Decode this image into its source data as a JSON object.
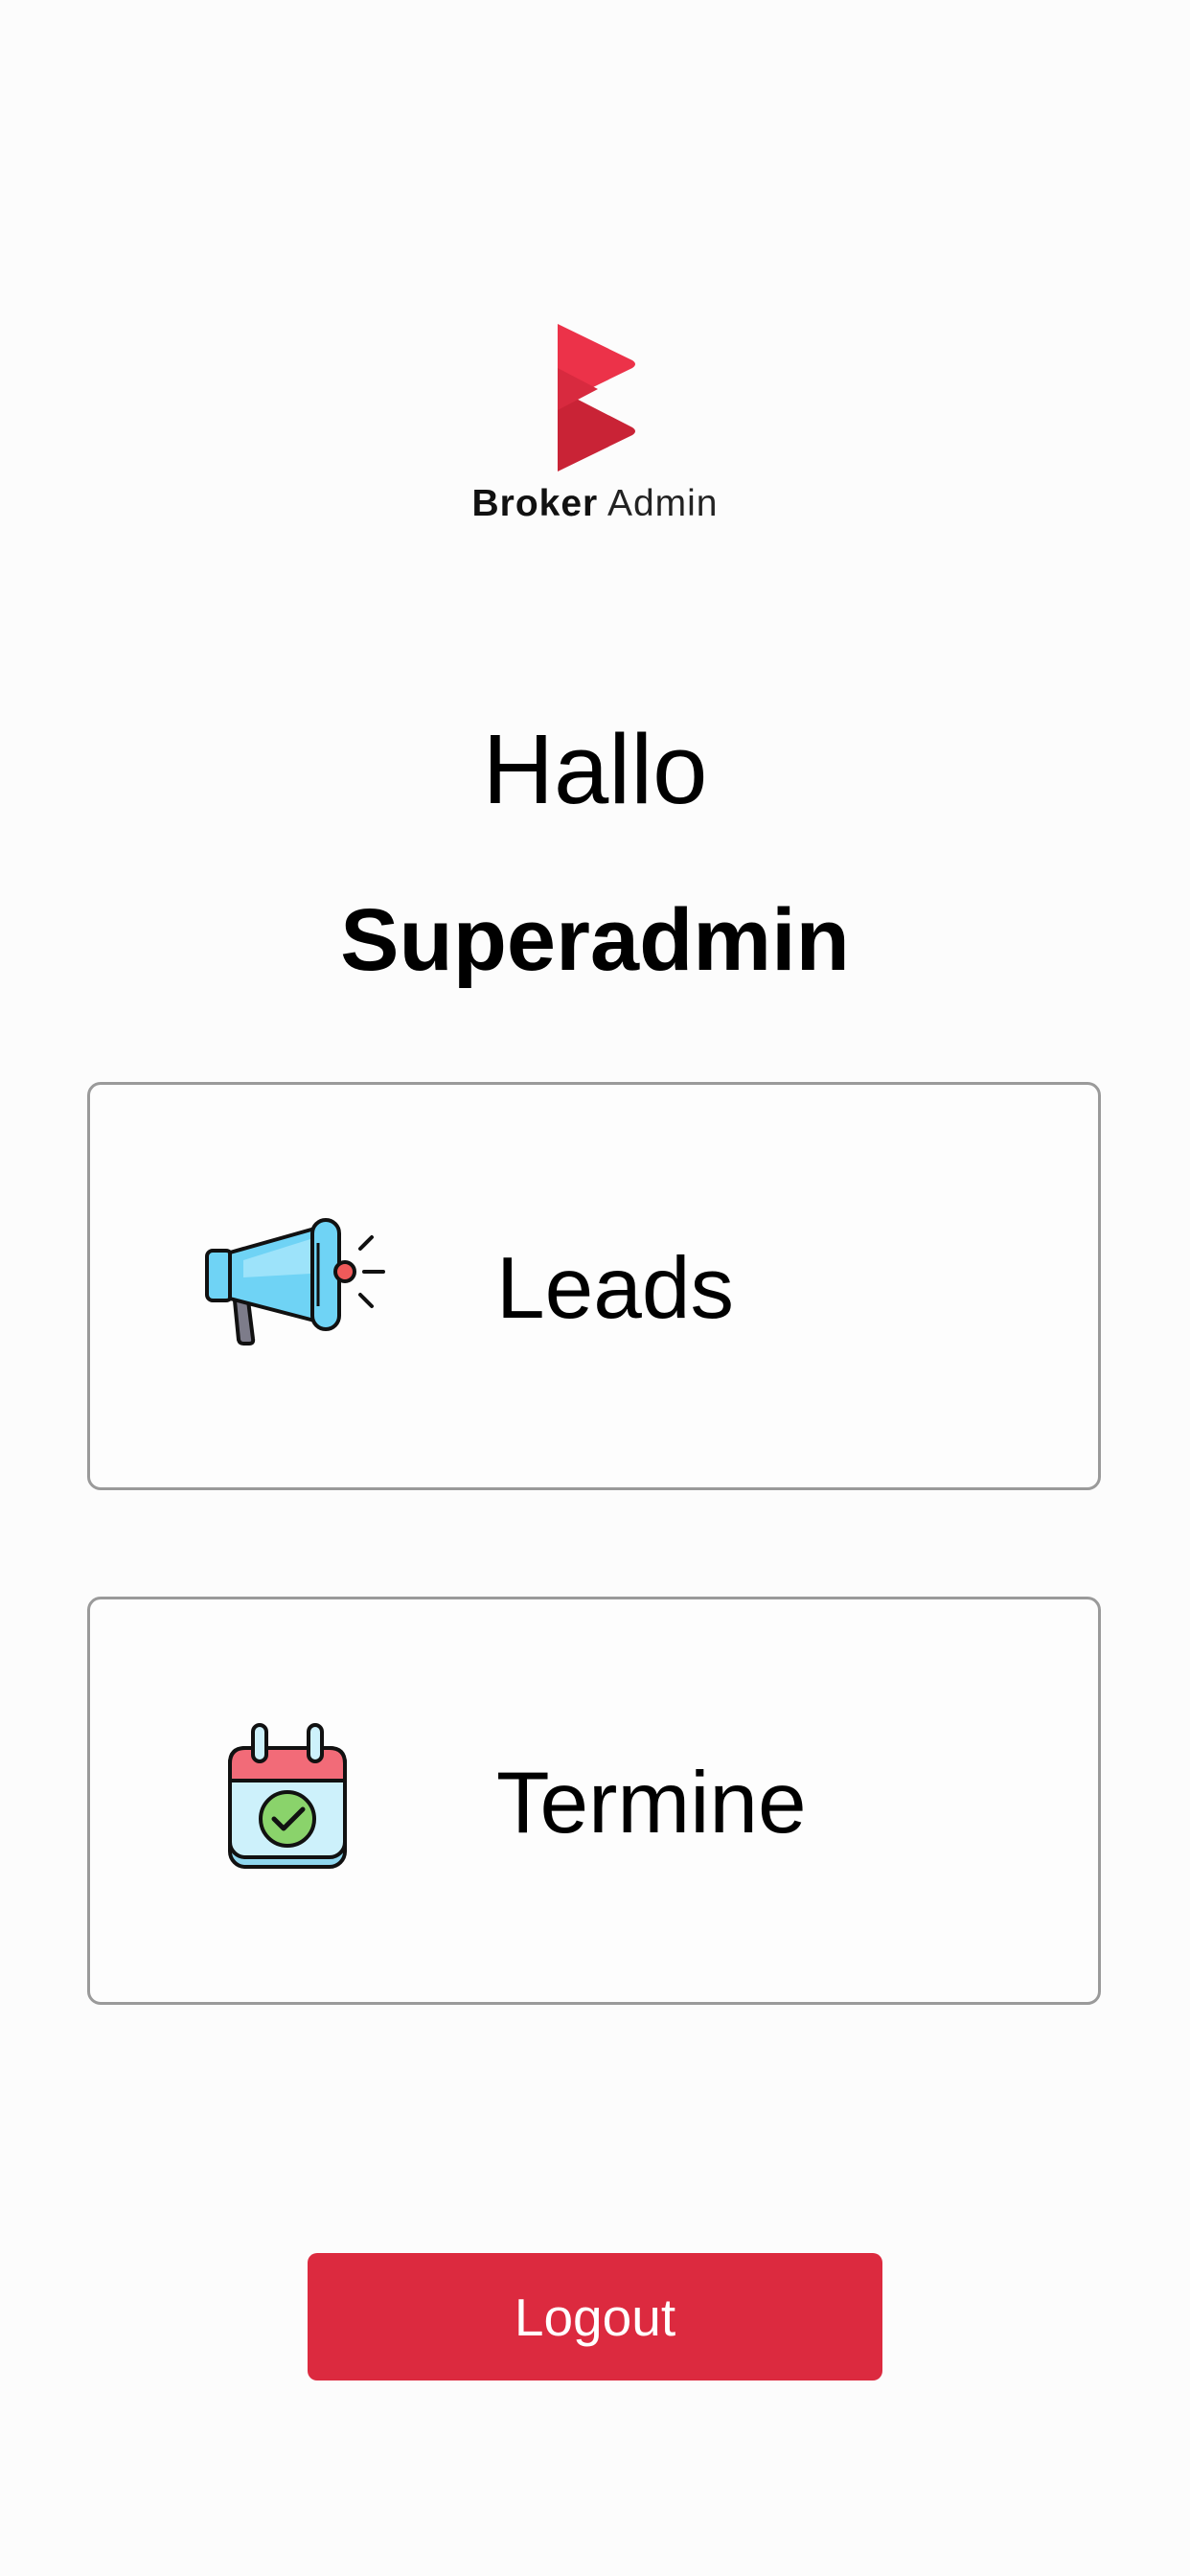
{
  "brand": {
    "name_strong": "Broker",
    "name_light": "Admin",
    "accent_color": "#dc2a3f"
  },
  "greeting": {
    "hello": "Hallo",
    "user": "Superadmin"
  },
  "menu": [
    {
      "label": "Leads",
      "icon": "megaphone-icon"
    },
    {
      "label": "Termine",
      "icon": "calendar-check-icon"
    }
  ],
  "logout": {
    "label": "Logout"
  }
}
